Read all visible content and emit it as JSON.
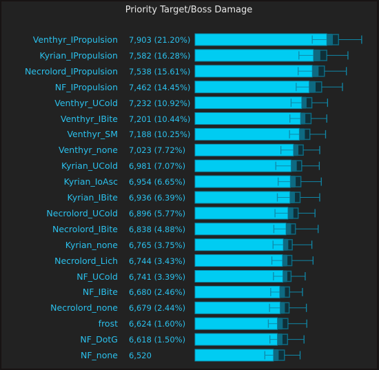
{
  "chart_data": {
    "type": "bar",
    "title": "Priority Target/Boss Damage",
    "xlabel": "",
    "ylabel": "",
    "grid": false,
    "legend": "none",
    "bar_color": "#00ccf2",
    "box_color": "#0e6a82",
    "box_inner_color": "#0f2f38",
    "whisker_color": "#1088a8",
    "label_color": "#2bc0ec",
    "xlim": [
      0,
      8600
    ],
    "categories": [
      "Venthyr_IPropulsion",
      "Kyrian_IPropulsion",
      "Necrolord_IPropulsion",
      "NF_IPropulsion",
      "Venthyr_UCold",
      "Venthyr_IBite",
      "Venthyr_SM",
      "Venthyr_none",
      "Kyrian_UCold",
      "Kyrian_IoAsc",
      "Kyrian_IBite",
      "Necrolord_UCold",
      "Necrolord_IBite",
      "Kyrian_none",
      "Necrolord_Lich",
      "NF_UCold",
      "NF_IBite",
      "Necrolord_none",
      "frost",
      "NF_DotG",
      "NF_none"
    ],
    "values": [
      7903,
      7582,
      7538,
      7462,
      7232,
      7201,
      7188,
      7023,
      6981,
      6954,
      6936,
      6896,
      6838,
      6765,
      6744,
      6741,
      6680,
      6679,
      6624,
      6618,
      6520
    ],
    "value_labels": [
      "7,903 (21.20%)",
      "7,582 (16.28%)",
      "7,538 (15.61%)",
      "7,462 (14.45%)",
      "7,232 (10.92%)",
      "7,201 (10.44%)",
      "7,188 (10.25%)",
      "7,023 (7.72%)",
      "6,981 (7.07%)",
      "6,954 (6.65%)",
      "6,936 (6.39%)",
      "6,896 (5.77%)",
      "6,838 (4.88%)",
      "6,765 (3.75%)",
      "6,744 (3.43%)",
      "6,741 (3.39%)",
      "6,680 (2.46%)",
      "6,679 (2.44%)",
      "6,624 (1.60%)",
      "6,618 (1.50%)",
      "6,520"
    ],
    "whisker_low": [
      7390,
      7050,
      7030,
      6980,
      6850,
      6820,
      6810,
      6590,
      6460,
      6520,
      6500,
      6440,
      6410,
      6390,
      6360,
      6400,
      6330,
      6300,
      6270,
      6310,
      6180
    ],
    "whisker_high": [
      8650,
      8300,
      8260,
      8160,
      7780,
      7760,
      7730,
      7580,
      7570,
      7620,
      7580,
      7460,
      7540,
      7380,
      7410,
      7210,
      7140,
      7240,
      7250,
      7180,
      7080
    ],
    "box_low": [
      7760,
      7420,
      7390,
      7310,
      7120,
      7090,
      7060,
      6910,
      6850,
      6830,
      6820,
      6770,
      6720,
      6650,
      6630,
      6640,
      6560,
      6570,
      6500,
      6500,
      6400
    ],
    "box_high": [
      8060,
      7760,
      7700,
      7630,
      7380,
      7360,
      7330,
      7160,
      7120,
      7100,
      7080,
      7030,
      6960,
      6880,
      6870,
      6850,
      6810,
      6800,
      6770,
      6760,
      6680
    ]
  }
}
